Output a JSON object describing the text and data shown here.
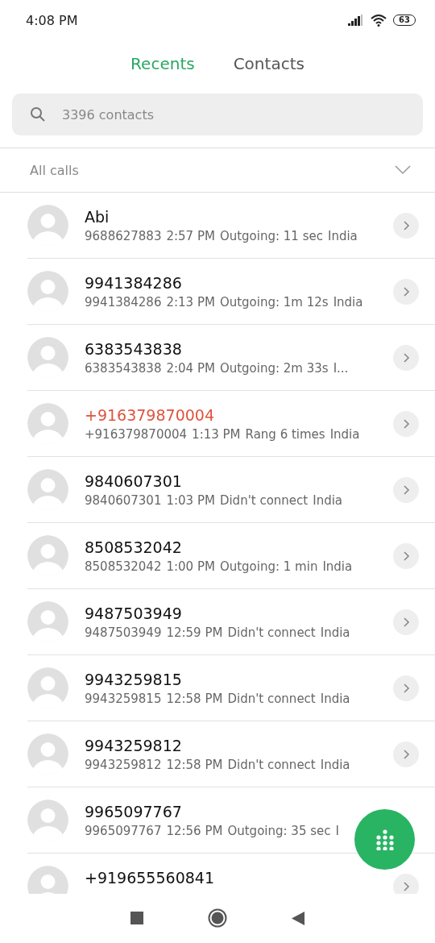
{
  "status_bar": {
    "time": "4:08 PM",
    "battery": "63"
  },
  "tabs": [
    {
      "label": "Recents",
      "selected": true
    },
    {
      "label": "Contacts",
      "selected": false
    }
  ],
  "search": {
    "placeholder": "3396 contacts"
  },
  "filter": {
    "label": "All calls"
  },
  "calls": [
    {
      "name": "Abi",
      "number": "9688627883",
      "time": "2:57 PM",
      "info": "Outgoing: 11 sec",
      "location": "India",
      "missed": false
    },
    {
      "name": "9941384286",
      "number": "9941384286",
      "time": "2:13 PM",
      "info": "Outgoing: 1m 12s",
      "location": "India",
      "missed": false
    },
    {
      "name": "6383543838",
      "number": "6383543838",
      "time": "2:04 PM",
      "info": "Outgoing: 2m 33s",
      "location": "I...",
      "missed": false
    },
    {
      "name": "+916379870004",
      "number": "+916379870004",
      "time": "1:13 PM",
      "info": "Rang 6 times",
      "location": "India",
      "missed": true
    },
    {
      "name": "9840607301",
      "number": "9840607301",
      "time": "1:03 PM",
      "info": "Didn't connect",
      "location": "India",
      "missed": false
    },
    {
      "name": "8508532042",
      "number": "8508532042",
      "time": "1:00 PM",
      "info": "Outgoing: 1 min",
      "location": "India",
      "missed": false
    },
    {
      "name": "9487503949",
      "number": "9487503949",
      "time": "12:59 PM",
      "info": "Didn't connect",
      "location": "India",
      "missed": false
    },
    {
      "name": "9943259815",
      "number": "9943259815",
      "time": "12:58 PM",
      "info": "Didn't connect",
      "location": "India",
      "missed": false
    },
    {
      "name": "9943259812",
      "number": "9943259812",
      "time": "12:58 PM",
      "info": "Didn't connect",
      "location": "India",
      "missed": false
    },
    {
      "name": "9965097767",
      "number": "9965097767",
      "time": "12:56 PM",
      "info": "Outgoing: 35 sec",
      "location": "I",
      "missed": false
    },
    {
      "name": "+919655560841",
      "missed": false
    }
  ]
}
